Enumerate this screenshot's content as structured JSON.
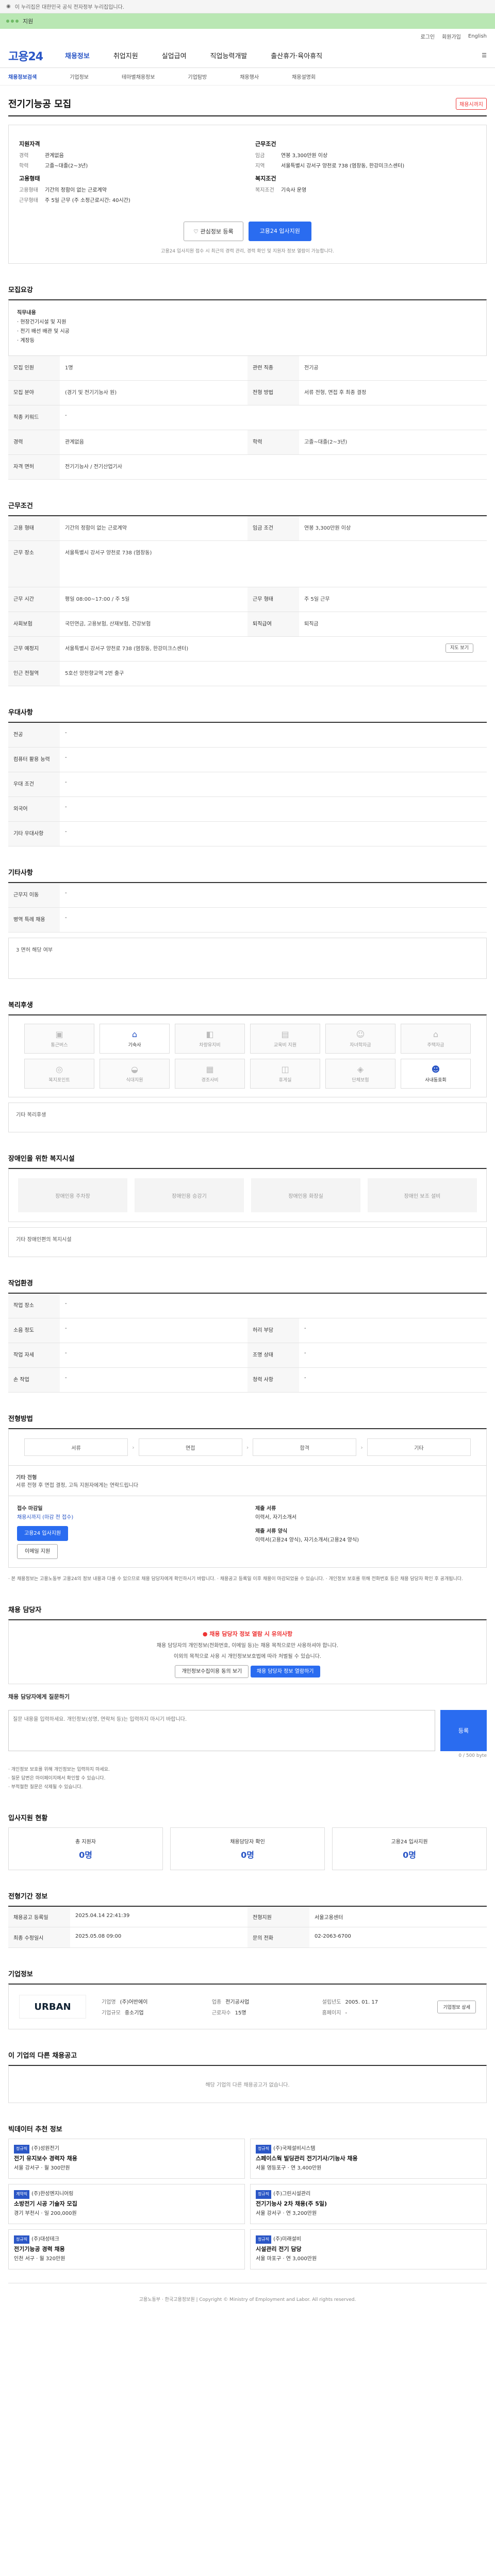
{
  "topbar": {
    "text": "이 누리집은 대한민국 공식 전자정부 누리집입니다."
  },
  "ribbon": {
    "label": "지원"
  },
  "util": [
    "로그인",
    "회원가입",
    "English"
  ],
  "gnb": {
    "logo": "고용24",
    "menu": [
      "채용정보",
      "취업지원",
      "실업급여",
      "직업능력개발",
      "출산휴가·육아휴직"
    ]
  },
  "lnb": [
    "채용정보검색",
    "기업정보",
    "테마별채용정보",
    "기업탐방",
    "채용행사",
    "채용설명회"
  ],
  "job": {
    "title": "전기기능공 모집",
    "badge": "채용시까지",
    "company_h": "지원자격",
    "company": [
      [
        "경력",
        "관계없음"
      ],
      [
        "학력",
        "고졸~대졸(2~3년)"
      ]
    ],
    "condition_h": "근무조건",
    "condition": [
      [
        "임금",
        "연봉 3,300만원 이상"
      ],
      [
        "지역",
        "서울특별시 강서구 양천로 738 (염창동, 한강미크스센터)"
      ]
    ],
    "type_h": "고용형태",
    "type": [
      [
        "고용형태",
        "기간의 정함이 없는 근로계약"
      ],
      [
        "근무형태",
        "주 5일 근무 (주 소정근로시간: 40시간)"
      ]
    ],
    "benefit_h": "복지조건",
    "benefit": [
      [
        "복지조건",
        "기숙사 운영"
      ]
    ],
    "btn_scrap": "관심정보 등록",
    "btn_apply": "고용24 입사지원",
    "note": "고용24 입사지원 접수 시 최근의 경력 관리, 경력 확인 및 지원자 정보 열람이 가능합니다."
  },
  "req": {
    "title": "모집요강",
    "desc_h": "직무내용",
    "desc": [
      "· 현장건기시설 및 지원",
      "· 전기 배선 배관 및 시공",
      "· 계장등"
    ],
    "rows": [
      [
        "모집 인원",
        "1명",
        "관련 직종",
        "전기공"
      ],
      [
        "모집 분야",
        "(경기 및 전기기능사 원)",
        "전형 방법",
        "서류 전형, 면접 후 최종 결정"
      ],
      [
        "직종 키워드",
        "-",
        "",
        ""
      ],
      [
        "경력",
        "관계없음",
        "학력",
        "고졸~대졸(2~3년)"
      ],
      [
        "자격 면허",
        "전기기능사 / 전기산업기사",
        "",
        ""
      ]
    ]
  },
  "work": {
    "title": "근무조건",
    "rows": [
      [
        "고용 형태",
        "기간의 정함이 없는 근로계약",
        "임금 조건",
        "연봉 3,300만원 이상"
      ],
      [
        "근무 장소",
        "서울특별시 강서구 양천로 738 (염창동)",
        "",
        ""
      ],
      [
        "근무 시간",
        "평일 08:00~17:00 / 주 5일",
        "근무 형태",
        "주 5일 근무"
      ],
      [
        "사회보험",
        "국민연금, 고용보험, 산재보험, 건강보험",
        "퇴직급여",
        "퇴직금"
      ],
      [
        "근무 예정지",
        "서울특별시 강서구 양천로 738 (염창동, 한강미크스센터)",
        "",
        ""
      ],
      [
        "인근 전철역",
        "5호선 양천향교역 2번 출구",
        "",
        ""
      ]
    ],
    "map_label": "지도 보기"
  },
  "extra": {
    "title": "우대사항",
    "rows": [
      [
        "전공",
        "-"
      ],
      [
        "컴퓨터 활용 능력",
        "-"
      ],
      [
        "우대 조건",
        "-"
      ],
      [
        "외국어",
        "-"
      ],
      [
        "기타 우대사항",
        "-"
      ]
    ]
  },
  "misc": {
    "title": "기타사항",
    "rows": [
      [
        "근무지 이동",
        "-"
      ],
      [
        "병역 특례 채용",
        "-"
      ]
    ],
    "more": "3 면허 해당 여부"
  },
  "welfare": {
    "title": "복리후생",
    "items": [
      {
        "label": "통근버스",
        "icon": "bus-icon",
        "on": false
      },
      {
        "label": "기숙사",
        "icon": "home-icon",
        "on": true
      },
      {
        "label": "차량유지비",
        "icon": "car-icon",
        "on": false
      },
      {
        "label": "교육비 지원",
        "icon": "book-icon",
        "on": false
      },
      {
        "label": "자녀학자금",
        "icon": "child-icon",
        "on": false
      },
      {
        "label": "주택자금",
        "icon": "house-icon",
        "on": false
      },
      {
        "label": "복지포인트",
        "icon": "point-icon",
        "on": false
      },
      {
        "label": "식대지원",
        "icon": "meal-icon",
        "on": false
      },
      {
        "label": "경조사비",
        "icon": "gift-icon",
        "on": false
      },
      {
        "label": "휴게실",
        "icon": "rest-icon",
        "on": false
      },
      {
        "label": "단체보험",
        "icon": "shield-icon",
        "on": false
      },
      {
        "label": "사내동호회",
        "icon": "group-icon",
        "on": true
      }
    ],
    "etc": "기타 복리후생"
  },
  "disabled": {
    "title": "장애인을 위한 복지시설",
    "items": [
      "장애인용 주차장",
      "장애인용 승강기",
      "장애인용 화장실",
      "장애인 보조 설비"
    ],
    "etc": "기타 장애인편의 복지시설"
  },
  "work_env": {
    "title": "작업환경",
    "rows": [
      [
        "작업 장소",
        "-",
        "",
        ""
      ],
      [
        "소음 정도",
        "-",
        "허리 부담",
        "-"
      ],
      [
        "작업 자세",
        "-",
        "조명 상태",
        "-"
      ],
      [
        "손 작업",
        "-",
        "청력 사항",
        "-"
      ]
    ]
  },
  "process": {
    "title": "전형방법",
    "steps": [
      "서류",
      "면접",
      "합격",
      "기타"
    ],
    "etc_h": "기타 전형",
    "etc": "서류 전형 후 면접 결정, 고득 지원자에게는 연락드립니다",
    "apply_h": "접수 마감일",
    "apply_date": "채용시까지 (마감 전 접수)",
    "apply_btn": "고용24 입사지원",
    "email_btn": "이메일 지원",
    "docs_h": "제출 서류",
    "docs": "이력서, 자기소개서",
    "method_h": "제출 서류 양식",
    "method": "이력서(고용24 양식), 자기소개서(고용24 양식)"
  },
  "fine": "· 본 채용정보는 고용노동부 고용24의 정보 내용과 다를 수 있으므로 채용 담당자에게 확인하시기 바랍니다. · 채용공고 등록일 이후 채용이 마감되었을 수 있습니다. · 개인정보 보호를 위해 전화번호 등은 채용 담당자 확인 후 공개됩니다.",
  "manager": {
    "title": "채용 담당자",
    "warn": "채용 담당자 정보 열람 시 유의사항",
    "p1": "채용 담당자의 개인정보(전화번호, 이메일 등)는 채용 목적으로만 사용하셔야 합니다.",
    "p2": "이외의 목적으로 사용 시 개인정보보호법에 따라 처벌될 수 있습니다.",
    "b1": "개인정보수집이용 동의 보기",
    "b2": "채용 담당자 정보 열람하기",
    "qa_h": "채용 담당자에게 질문하기",
    "qa_ph": "질문 내용을 입력하세요. 개인정보(성명, 연락처 등)는 입력하지 마시기 바랍니다.",
    "qa_btn": "등록",
    "counter": "0 / 500 byte",
    "notes": [
      "· 개인정보 보호를 위해 개인정보는 입력하지 마세요.",
      "· 질문 답변은 마이페이지에서 확인할 수 있습니다.",
      "· 부적절한 질문은 삭제될 수 있습니다."
    ]
  },
  "applicants": {
    "title": "입사지원 현황",
    "stats": [
      [
        "총 지원자",
        "0명"
      ],
      [
        "채용담당자 확인",
        "0명"
      ],
      [
        "고용24 입사지원",
        "0명"
      ]
    ]
  },
  "meta": {
    "title": "전형기간 정보",
    "rows": [
      [
        "채용공고 등록일",
        "2025.04.14 22:41:39",
        "전형지원",
        "서울고용센터"
      ],
      [
        "최종 수정일시",
        "2025.05.08 09:00",
        "문의 전화",
        "02-2063-6700"
      ]
    ]
  },
  "company": {
    "title": "기업정보",
    "logo": "URBAN",
    "fields": [
      [
        "기업명",
        "(주)어반에이"
      ],
      [
        "업종",
        "전기공사업"
      ],
      [
        "설립년도",
        "2005. 01. 17"
      ],
      [
        "기업규모",
        "중소기업"
      ],
      [
        "근로자수",
        "15명"
      ],
      [
        "홈페이지",
        "-"
      ]
    ],
    "more": "기업정보 상세"
  },
  "others": {
    "title": "이 기업의 다른 채용공고",
    "empty": "해당 기업의 다른 채용공고가 없습니다."
  },
  "reco": {
    "title": "빅데이터 추천 정보",
    "cards": [
      {
        "co": "(주)성원전기",
        "title": "전기 유지보수 경력자 채용",
        "tag": "정규직",
        "loc": "서울 강서구",
        "sal": "월 300만원"
      },
      {
        "co": "(주)국제설비시스템",
        "title": "스페이스웍 빌딩관리 전기기사/기능사 채용",
        "tag": "정규직",
        "loc": "서울 영등포구",
        "sal": "연 3,400만원"
      },
      {
        "co": "(주)한성엔지니어링",
        "title": "소방전기 시공 기술자 모집",
        "tag": "계약직",
        "loc": "경기 부천시",
        "sal": "일 200,000원"
      },
      {
        "co": "(주)그린시설관리",
        "title": "전기기능사 2차 채용(주 5일)",
        "tag": "정규직",
        "loc": "서울 강서구",
        "sal": "연 3,200만원"
      },
      {
        "co": "(주)대성테크",
        "title": "전기기능공 경력 채용",
        "tag": "정규직",
        "loc": "인천 서구",
        "sal": "월 320만원"
      },
      {
        "co": "(주)미래설비",
        "title": "시설관리 전기 담당",
        "tag": "정규직",
        "loc": "서울 마포구",
        "sal": "연 3,000만원"
      }
    ]
  },
  "footer": "고용노동부 · 한국고용정보원 | Copyright © Ministry of Employment and Labor. All rights reserved."
}
